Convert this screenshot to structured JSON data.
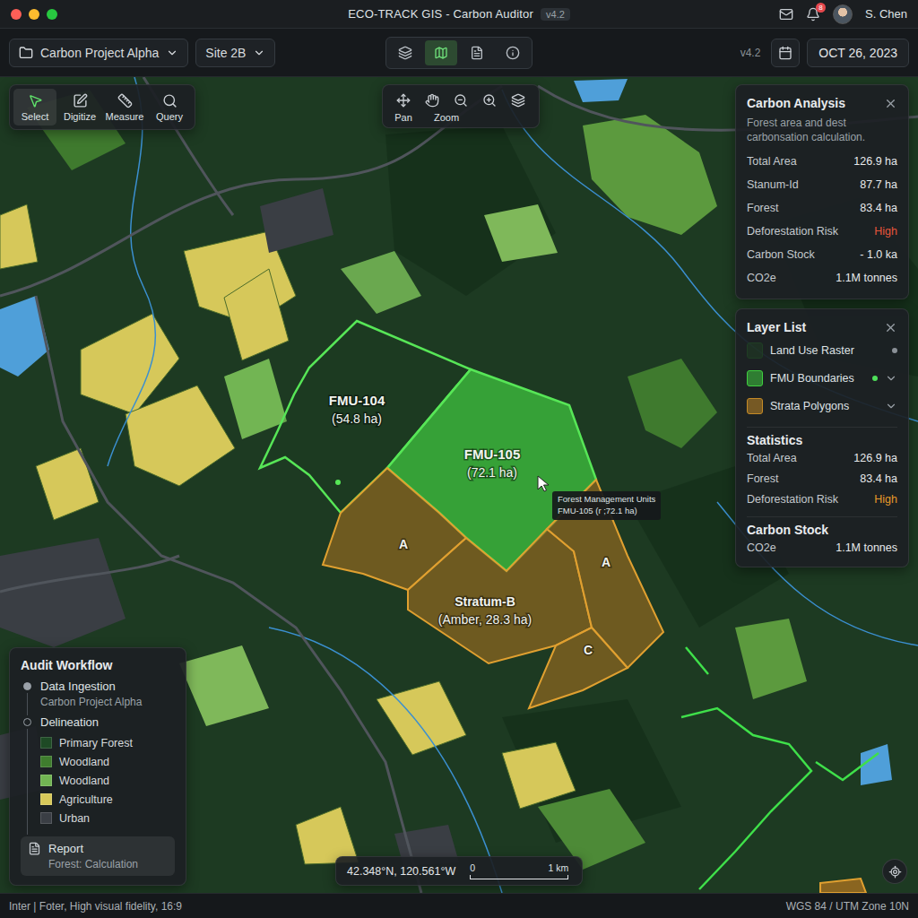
{
  "window": {
    "title": "ECO-TRACK GIS - Carbon Auditor",
    "version": "v4.2",
    "notifications": "8",
    "user": "S. Chen"
  },
  "toolbar": {
    "project": "Carbon Project Alpha",
    "site": "Site 2B",
    "view_modes": [
      {
        "selected": false
      },
      {
        "selected": true
      },
      {
        "selected": false
      },
      {
        "selected": false
      }
    ],
    "version": "v4.2",
    "date": "OCT 26, 2023"
  },
  "tools": [
    {
      "label": "Select",
      "selected": true
    },
    {
      "label": "Digitize",
      "selected": false
    },
    {
      "label": "Measure",
      "selected": false
    },
    {
      "label": "Query",
      "selected": false
    }
  ],
  "nav": {
    "labels": [
      "Pan",
      "Zoom"
    ]
  },
  "carbon_analysis": {
    "title": "Carbon Analysis",
    "subtitle": "Forest area and dest carbonsation calculation.",
    "rows": [
      {
        "label": "Total Area",
        "value": "126.9 ha"
      },
      {
        "label": "Stanum-Id",
        "value": "87.7 ha"
      },
      {
        "label": "Forest",
        "value": "83.4 ha"
      },
      {
        "label": "Deforestation Risk",
        "value": "High",
        "color": "#e8553b"
      },
      {
        "label": "Carbon Stock",
        "value": "- 1.0 ka"
      },
      {
        "label": "CO2e",
        "value": "1.1M tonnes"
      }
    ]
  },
  "layer_list": {
    "title": "Layer List",
    "layers": [
      {
        "name": "Land Use Raster",
        "color": "#1f3d24",
        "dot": true,
        "dot_active": false,
        "expandable": false
      },
      {
        "name": "FMU Boundaries",
        "color": "#3fcf3f",
        "dot": true,
        "dot_active": true,
        "expandable": true
      },
      {
        "name": "Strata Polygons",
        "color": "#c48a26",
        "dot": false,
        "dot_active": false,
        "expandable": true
      }
    ],
    "statistics_title": "Statistics",
    "statistics": [
      {
        "label": "Total Area",
        "value": "126.9 ha"
      },
      {
        "label": "Forest",
        "value": "83.4 ha"
      },
      {
        "label": "Deforestation Risk",
        "value": "High",
        "color": "#e89a2a"
      }
    ],
    "carbon_title": "Carbon Stock",
    "carbon": [
      {
        "label": "CO2e",
        "value": "1.1M tonnes"
      }
    ]
  },
  "workflow": {
    "title": "Audit Workflow",
    "steps": [
      {
        "title": "Data Ingestion",
        "subtitle": "Carbon Project Alpha",
        "done": true
      },
      {
        "title": "Delineation",
        "done": false
      }
    ],
    "legend": [
      {
        "label": "Primary Forest",
        "color": "#1e4a25"
      },
      {
        "label": "Woodland",
        "color": "#3f7d2e"
      },
      {
        "label": "Woodland",
        "color": "#72b553"
      },
      {
        "label": "Agriculture",
        "color": "#d8c95a"
      },
      {
        "label": "Urban",
        "color": "#3a3e44"
      }
    ],
    "report": {
      "title": "Report",
      "subtitle": "Forest: Calculation",
      "selected": true
    }
  },
  "map": {
    "units": [
      {
        "name": "FMU-104",
        "area": "(54.8 ha)",
        "selected": false
      },
      {
        "name": "FMU-105",
        "area": "(72.1 ha)",
        "selected": true
      }
    ],
    "strata": [
      {
        "label": "A"
      },
      {
        "label": "Stratum-B",
        "area": "(Amber, 28.3 ha)"
      },
      {
        "label": "A"
      },
      {
        "label": "C"
      }
    ],
    "tooltip": {
      "title": "Forest Management Units",
      "text": "FMU-105 (r ;72.1 ha)"
    },
    "coords": "42.348°N, 120.561°W",
    "scale": {
      "start": "0",
      "end": "1 km"
    }
  },
  "status_bar": {
    "left": "Inter | Foter, High visual fidelity, 16:9",
    "right": "WGS 84 / UTM Zone 10N"
  }
}
